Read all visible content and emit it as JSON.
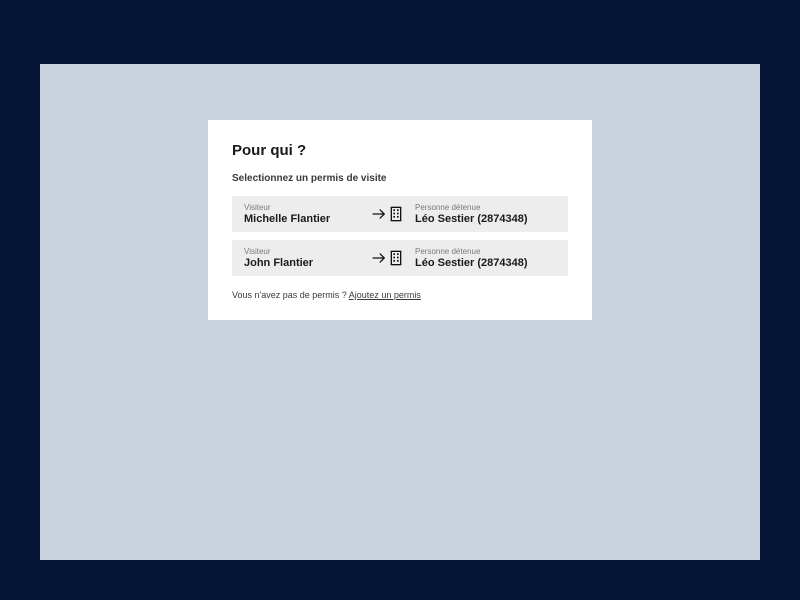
{
  "card": {
    "title": "Pour qui ?",
    "subtitle": "Selectionnez un permis de visite",
    "visitor_label": "Visiteur",
    "detainee_label": "Personne détenue",
    "permits": [
      {
        "visitor": "Michelle Flantier",
        "detainee": "Léo Sestier (2874348)"
      },
      {
        "visitor": "John Flantier",
        "detainee": "Léo Sestier (2874348)"
      }
    ],
    "footer_prefix": "Vous n'avez pas de permis ? ",
    "footer_link": "Ajoutez un permis"
  }
}
